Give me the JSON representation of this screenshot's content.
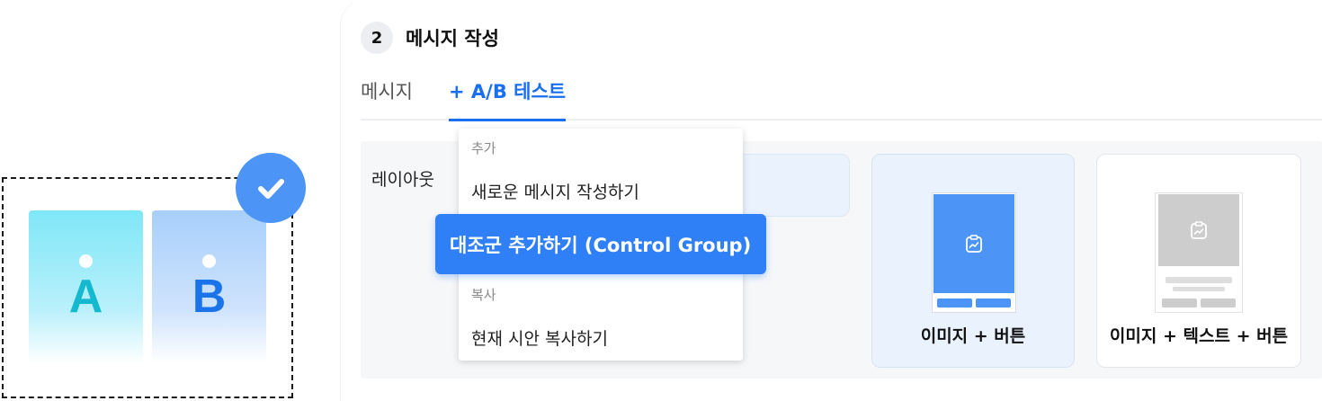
{
  "illustration": {
    "card_a": "A",
    "card_b": "B",
    "badge_icon": "check-icon",
    "colors": {
      "a_letter": "#14b8cf",
      "b_letter": "#1a73e8",
      "badge": "#4c94f5"
    }
  },
  "step": {
    "number": "2",
    "title": "메시지 작성"
  },
  "tabs": [
    {
      "label": "메시지",
      "active": false
    },
    {
      "label": "+ A/B 테스트",
      "active": true
    }
  ],
  "layout": {
    "label": "레이아웃",
    "options": [
      {
        "label": "",
        "selected": false
      },
      {
        "label": "이미지 + 버튼",
        "selected": true,
        "icon": "clipboard-chart-icon"
      },
      {
        "label": "이미지 + 텍스트 + 버튼",
        "selected": false,
        "icon": "clipboard-chart-icon"
      }
    ]
  },
  "dropdown": {
    "section_add": "추가",
    "item_new": "새로운 메시지 작성하기",
    "item_control": "대조군 추가하기 (Control Group)",
    "section_copy": "복사",
    "item_copy": "현재 시안 복사하기"
  },
  "colors": {
    "accent": "#1a6ff0",
    "highlight": "#2f80f7"
  }
}
